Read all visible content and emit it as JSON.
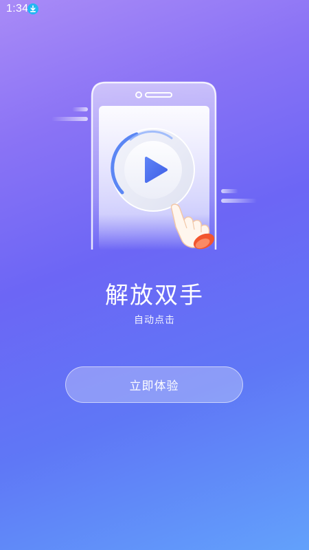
{
  "status_bar": {
    "time": "1:34",
    "notification_icon": "download-icon"
  },
  "onboarding": {
    "title": "解放双手",
    "subtitle": "自动点击",
    "cta_label": "立即体验"
  },
  "illustration": {
    "icons": [
      "phone-icon",
      "play-button-icon",
      "pointing-hand-icon"
    ]
  },
  "colors": {
    "background_top": "#a98bf7",
    "background_mid": "#6c66f5",
    "background_bottom": "#62a1fb",
    "play_icon": "#4f73f0",
    "cuff": "#f2552e",
    "download_badge": "#22b7f2"
  }
}
